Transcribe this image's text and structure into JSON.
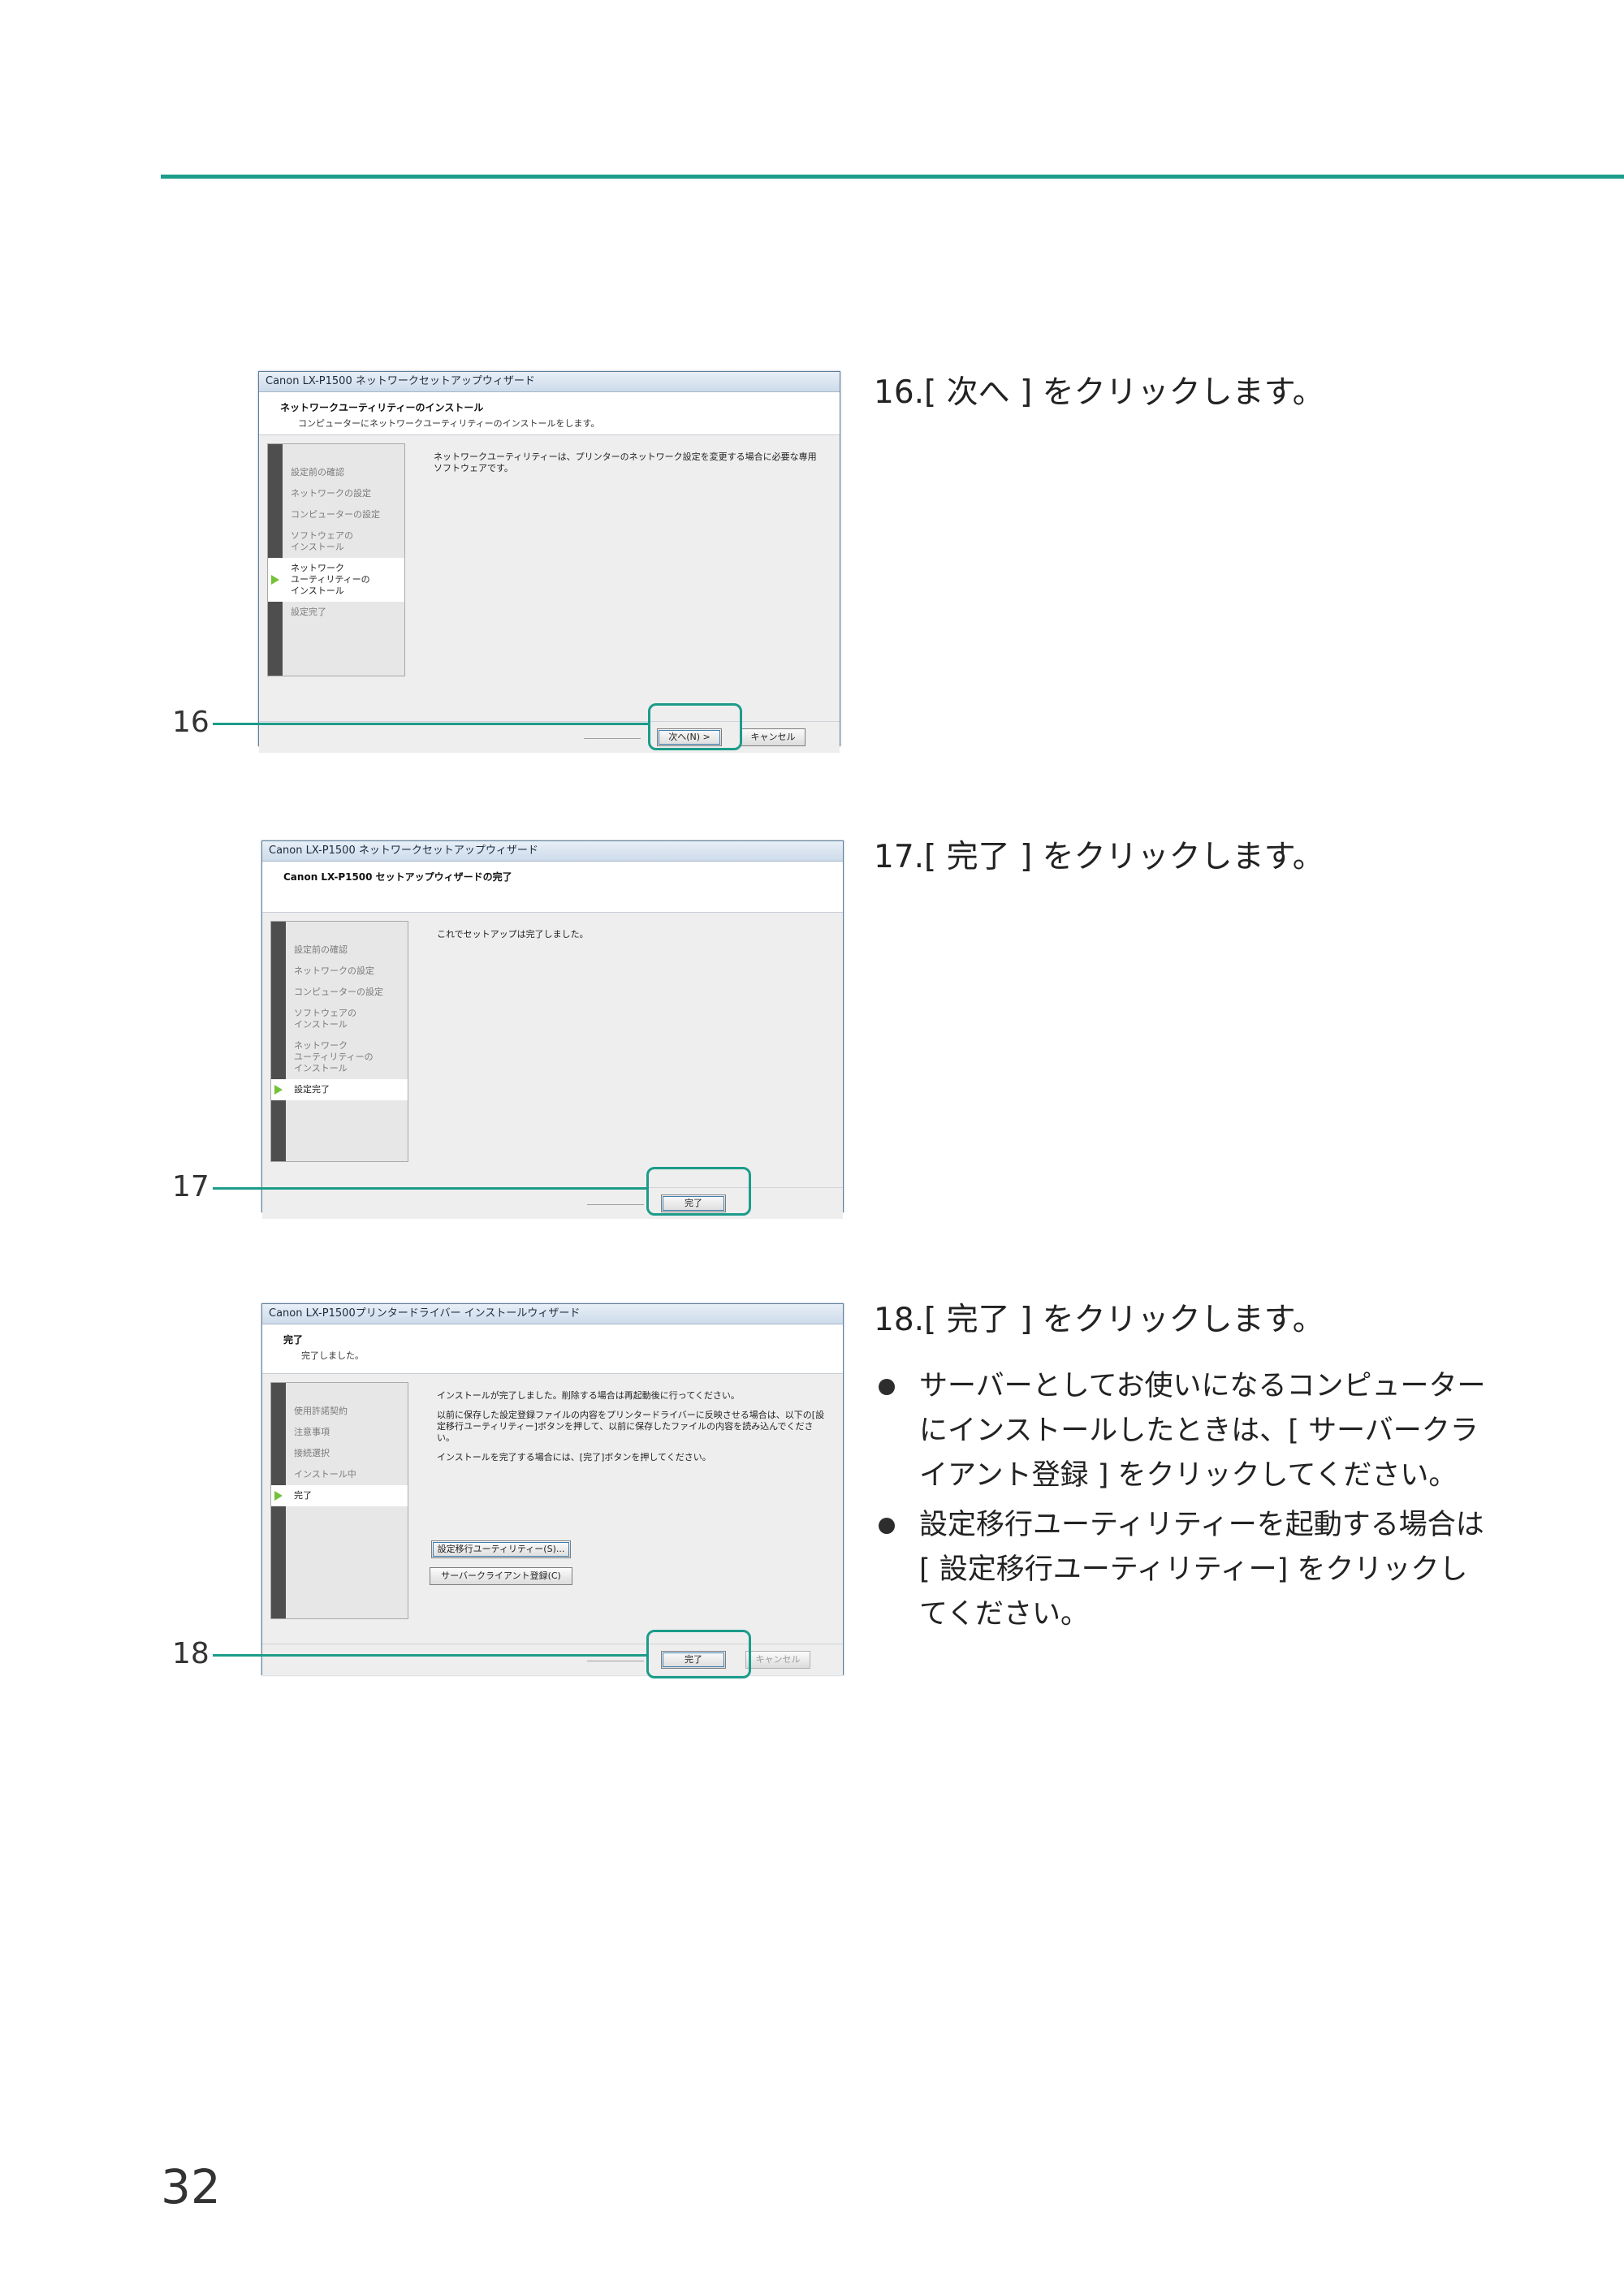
{
  "page_number": "32",
  "callouts": [
    "16",
    "17",
    "18"
  ],
  "steps": [
    {
      "text": "16.[ 次へ ] をクリックします。"
    },
    {
      "text": "17.[ 完了 ] をクリックします。"
    },
    {
      "text": "18.[ 完了 ] をクリックします。"
    }
  ],
  "bullets": [
    "サーバーとしてお使いになるコンピューターにインストールしたときは、[ サーバークライアント登録 ] をクリックしてください。",
    "設定移行ユーティリティーを起動する場合は [ 設定移行ユーティリティー] をクリックしてください。"
  ],
  "screens": {
    "s1": {
      "title": "Canon LX-P1500 ネットワークセットアップウィザード",
      "banner_title": "ネットワークユーティリティーのインストール",
      "banner_sub": "コンピューターにネットワークユーティリティーのインストールをします。",
      "side": [
        "設定前の確認",
        "ネットワークの設定",
        "コンピューターの設定",
        "ソフトウェアの\nインストール",
        "ネットワーク\nユーティリティーの\nインストール",
        "設定完了"
      ],
      "message": "ネットワークユーティリティーは、プリンターのネットワーク設定を変更する場合に必要な専用ソフトウェアです。",
      "btn_next": "次へ(N) >",
      "btn_cancel": "キャンセル"
    },
    "s2": {
      "title": "Canon LX-P1500 ネットワークセットアップウィザード",
      "banner_title": "Canon LX-P1500 セットアップウィザードの完了",
      "side": [
        "設定前の確認",
        "ネットワークの設定",
        "コンピューターの設定",
        "ソフトウェアの\nインストール",
        "ネットワーク\nユーティリティーの\nインストール",
        "設定完了"
      ],
      "message": "これでセットアップは完了しました。",
      "btn_finish": "完了"
    },
    "s3": {
      "title": "Canon LX-P1500プリンタードライバー インストールウィザード",
      "banner_title": "完了",
      "banner_sub": "完了しました。",
      "side": [
        "使用許諾契約",
        "注意事項",
        "接続選択",
        "インストール中",
        "完了"
      ],
      "msg1": "インストールが完了しました。削除する場合は再起動後に行ってください。",
      "msg2": "以前に保存した設定登録ファイルの内容をプリンタードライバーに反映させる場合は、以下の[設定移行ユーティリティー]ボタンを押して、以前に保存したファイルの内容を読み込んでください。",
      "msg3": "インストールを完了する場合には、[完了]ボタンを押してください。",
      "btn_migrate": "設定移行ユーティリティー(S)...",
      "btn_register": "サーバークライアント登録(C)",
      "btn_finish": "完了",
      "btn_cancel": "キャンセル"
    }
  }
}
